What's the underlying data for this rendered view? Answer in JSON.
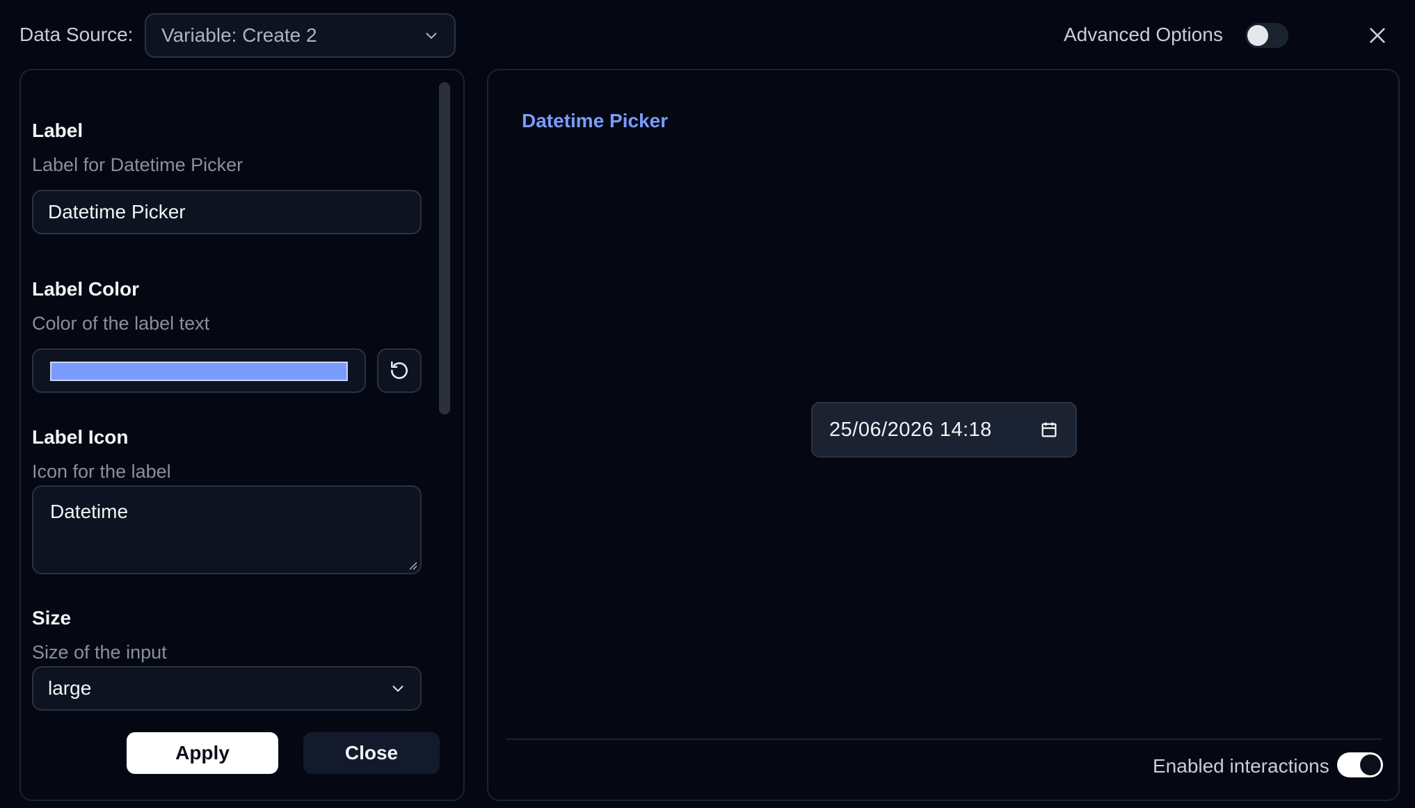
{
  "header": {
    "data_source_label": "Data Source:",
    "data_source_value": "Variable: Create 2",
    "advanced_options_label": "Advanced Options",
    "advanced_options_enabled": false,
    "close_icon": "close-icon"
  },
  "form": {
    "label": {
      "title": "Label",
      "description": "Label for Datetime Picker",
      "value": "Datetime Picker"
    },
    "label_color": {
      "title": "Label Color",
      "description": "Color of the label text",
      "value": "#7b9cff",
      "reset_icon": "reset-icon"
    },
    "label_icon": {
      "title": "Label Icon",
      "description": "Icon for the label",
      "value": "Datetime"
    },
    "size": {
      "title": "Size",
      "description": "Size of the input",
      "value": "large"
    },
    "apply_label": "Apply",
    "close_label": "Close"
  },
  "preview": {
    "label": "Datetime Picker",
    "datetime_value": "25/06/2026  14:18",
    "calendar_icon": "calendar-icon",
    "enabled_interactions_label": "Enabled interactions",
    "enabled_interactions": true
  },
  "colors": {
    "background": "#050812",
    "accent": "#7b9cff",
    "input_bg": "#0d1320",
    "border": "#2a3242"
  }
}
